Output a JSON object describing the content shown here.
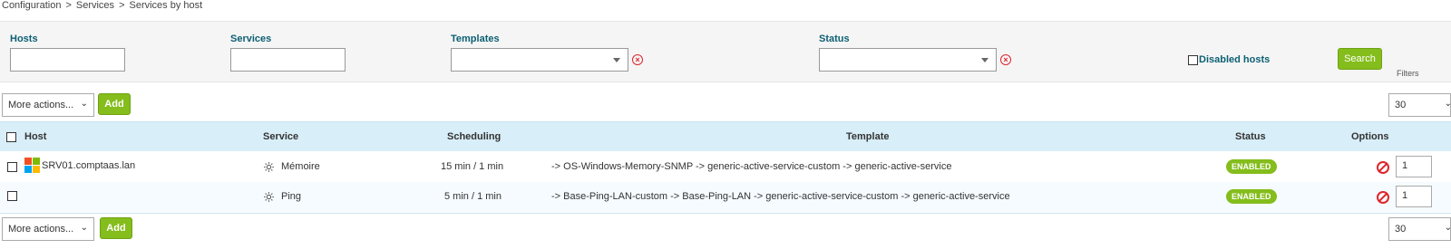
{
  "breadcrumb": [
    "Configuration",
    "Services",
    "Services by host"
  ],
  "filters": {
    "hosts_label": "Hosts",
    "services_label": "Services",
    "templates_label": "Templates",
    "status_label": "Status",
    "hosts_value": "",
    "services_value": "",
    "templates_value": "",
    "status_value": "",
    "disabled_hosts_label": "Disabled hosts",
    "disabled_hosts_checked": false,
    "search_label": "Search",
    "side_label": "Filters"
  },
  "toolbar_top": {
    "more_actions": "More actions...",
    "add": "Add",
    "per_page": "30"
  },
  "toolbar_bottom": {
    "more_actions": "More actions...",
    "add": "Add",
    "per_page": "30"
  },
  "table": {
    "headers": {
      "host": "Host",
      "service": "Service",
      "scheduling": "Scheduling",
      "template": "Template",
      "status": "Status",
      "options": "Options"
    },
    "rows": [
      {
        "host": "SRV01.comptaas.lan",
        "host_icon": "windows-icon",
        "service": "Mémoire",
        "scheduling": "15 min / 1 min",
        "template": "-> OS-Windows-Memory-SNMP -> generic-active-service-custom -> generic-active-service",
        "status": "ENABLED",
        "multiplier": "1"
      },
      {
        "host": "",
        "service": "Ping",
        "scheduling": "5 min / 1 min",
        "template": "-> Base-Ping-LAN-custom -> Base-Ping-LAN -> generic-active-service-custom -> generic-active-service",
        "status": "ENABLED",
        "multiplier": "1"
      }
    ]
  },
  "colors": {
    "accent_green": "#84bd1c",
    "header_bg": "#d8eef8",
    "label_teal": "#0b5f73",
    "error_red": "#e0252b"
  }
}
